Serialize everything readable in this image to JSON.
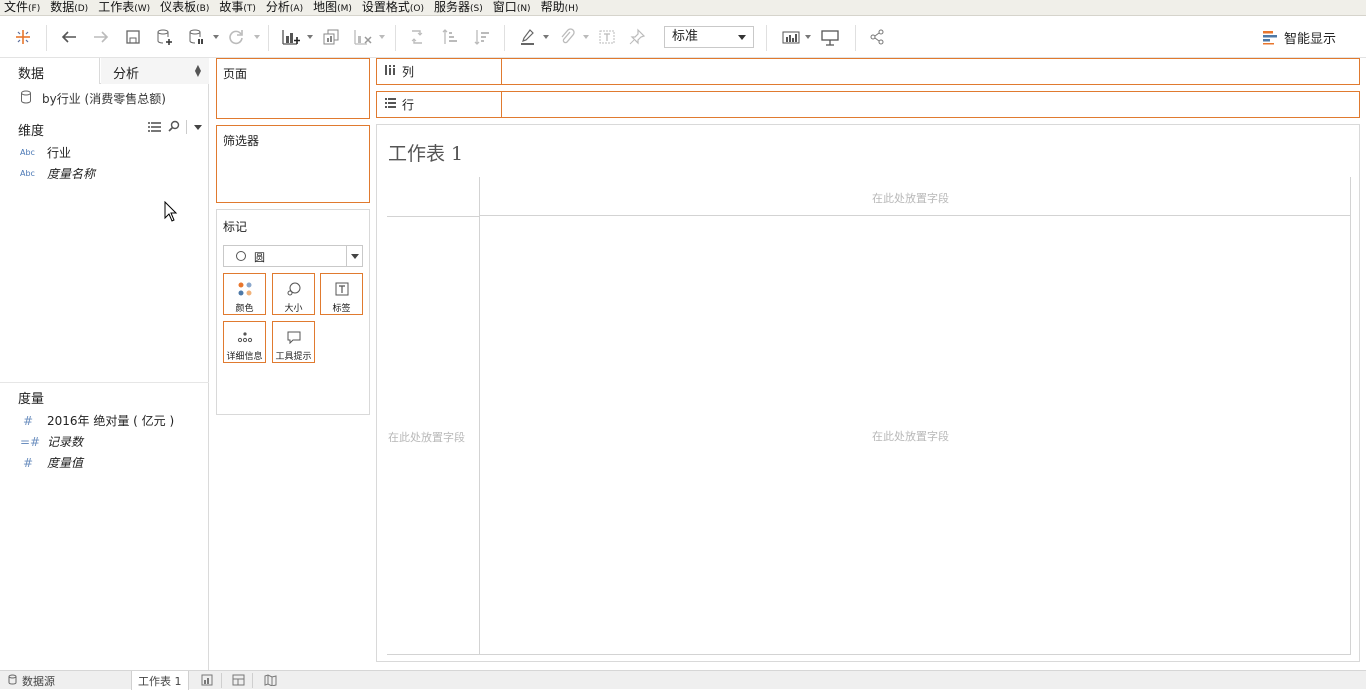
{
  "menu": {
    "items": [
      {
        "label": "文件",
        "accel": "(F)"
      },
      {
        "label": "数据",
        "accel": "(D)"
      },
      {
        "label": "工作表",
        "accel": "(W)"
      },
      {
        "label": "仪表板",
        "accel": "(B)"
      },
      {
        "label": "故事",
        "accel": "(T)"
      },
      {
        "label": "分析",
        "accel": "(A)"
      },
      {
        "label": "地图",
        "accel": "(M)"
      },
      {
        "label": "设置格式",
        "accel": "(O)"
      },
      {
        "label": "服务器",
        "accel": "(S)"
      },
      {
        "label": "窗口",
        "accel": "(N)"
      },
      {
        "label": "帮助",
        "accel": "(H)"
      }
    ]
  },
  "toolbar": {
    "fit_select": "标准",
    "show_me_label": "智能显示",
    "icons": [
      "tableau-logo-icon",
      "undo-icon",
      "redo-icon",
      "save-icon",
      "new-datasource-icon",
      "pause-updates-icon",
      "refresh-icon",
      "new-worksheet-icon",
      "duplicate-sheet-icon",
      "clear-sheet-icon",
      "swap-icon",
      "sort-ascending-icon",
      "sort-descending-icon",
      "highlight-icon",
      "group-icon",
      "label-icon",
      "pin-icon",
      "cards-icon",
      "presentation-icon",
      "share-icon"
    ]
  },
  "data_pane": {
    "tab_data": "数据",
    "tab_analysis": "分析",
    "datasource": "by行业 (消费零售总额)",
    "dimensions_title": "维度",
    "dimensions": [
      {
        "type": "Abc",
        "name": "行业",
        "italic": false
      },
      {
        "type": "Abc",
        "name": "度量名称",
        "italic": true
      }
    ],
    "measures_title": "度量",
    "measures": [
      {
        "type": "#",
        "name": "2016年 绝对量 ( 亿元 )",
        "italic": false
      },
      {
        "type": "=#",
        "name": "记录数",
        "italic": true
      },
      {
        "type": "#",
        "name": "度量值",
        "italic": true
      }
    ]
  },
  "cards": {
    "pages": "页面",
    "filters": "筛选器",
    "marks": "标记",
    "mark_type": "圆",
    "mark_buttons": [
      "颜色",
      "大小",
      "标签",
      "详细信息",
      "工具提示"
    ]
  },
  "shelves": {
    "columns": "列",
    "rows": "行"
  },
  "view": {
    "sheet_title": "工作表 1",
    "drop_top": "在此处放置字段",
    "drop_left": "在此处放置字段",
    "drop_center": "在此处放置字段"
  },
  "bottom": {
    "datasource_tab": "数据源",
    "sheet_tab": "工作表 1"
  }
}
